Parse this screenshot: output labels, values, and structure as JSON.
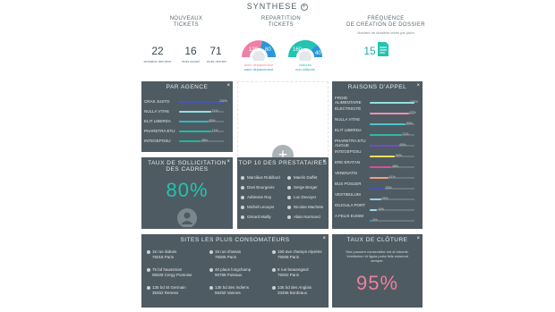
{
  "header": {
    "title": "SYNTHESE"
  },
  "tickets": {
    "title_line1": "NOUVEAUX",
    "title_line2": "TICKETS",
    "stats": [
      {
        "value": "22",
        "label": "semaine dernière"
      },
      {
        "value": "16",
        "label": "mois actuel"
      },
      {
        "value": "71",
        "label": "mois dernier"
      }
    ]
  },
  "repartition": {
    "title_line1": "REPARTITION",
    "title_line2": "TICKETS",
    "gauge_left": {
      "a": "120",
      "b": "80",
      "legend1": "avec déplacement",
      "legend2": "sans déplacement",
      "color_a": "#f07fa8",
      "color_b": "#2a97d8"
    },
    "gauge_right": {
      "a": "160",
      "b": "40",
      "legend1": "clôturés",
      "legend2": "non clôturés",
      "color_a": "#23c3b0",
      "color_b": "#2a97d8"
    }
  },
  "frequence": {
    "title_line1": "FRÉQUENCE",
    "title_line2": "DE CRÉATION DE DOSSIER",
    "subtitle": "Nombre de dossiers créés par jours",
    "value": "15"
  },
  "par_agence": {
    "title": "PAR AGENCE",
    "items": [
      {
        "label": "CRAS JUSTO",
        "pct": "100%",
        "value": 1.0,
        "color": "#4556b8"
      },
      {
        "label": "NULLA VITAE",
        "pct": "71%",
        "value": 0.71,
        "color": "#8fe0e8"
      },
      {
        "label": "ELIT LIBERDA",
        "pct": "65%",
        "value": 0.65,
        "color": "#2fb8c0"
      },
      {
        "label": "PHARETRA ETU",
        "pct": "71%",
        "value": 0.71,
        "color": "#23b8a8"
      },
      {
        "label": "INTEGEPOSU",
        "pct": "48%",
        "value": 0.48,
        "color": "#21b39c"
      }
    ]
  },
  "add_widget": {
    "symbol": "+"
  },
  "raisons": {
    "title": "RAISONS D'APPEL",
    "items": [
      {
        "label": "FROID ALIMENTAIRE",
        "pct": "100%",
        "value": 1.0,
        "color": "#8fe0e8"
      },
      {
        "label": "ÉLECTRICITÉ",
        "pct": "87%",
        "value": 0.87,
        "color": "#ef8fb8"
      },
      {
        "label": "NULLA VITAE",
        "pct": "80%",
        "value": 0.8,
        "color": "#4bc5ce"
      },
      {
        "label": "ELIT LIBERDA",
        "pct": "71%",
        "value": 0.71,
        "color": "#2fb8a8"
      },
      {
        "label": "PHARETRA ETU AUGUE",
        "pct": "65%",
        "value": 0.65,
        "color": "#6c4fc4"
      },
      {
        "label": "INTEGEPOSU",
        "pct": "56%",
        "value": 0.56,
        "color": "#e8e060"
      },
      {
        "label": "ERE ERATAN",
        "pct": "48%",
        "value": 0.48,
        "color": "#d64fa0"
      },
      {
        "label": "VENENATIS",
        "pct": "41%",
        "value": 0.41,
        "color": "#f0a080"
      },
      {
        "label": "BUS POSUER",
        "pct": "33%",
        "value": 0.33,
        "color": "#4556b8"
      },
      {
        "label": "VESTIBULUM",
        "pct": "25%",
        "value": 0.25,
        "color": "#8fd0e8"
      },
      {
        "label": "IDLIGULA PORT",
        "pct": "16%",
        "value": 0.16,
        "color": "#9fd8e8"
      },
      {
        "label": "A FELIS EUISM",
        "pct": "5%",
        "value": 0.05,
        "color": "#2a97d8"
      }
    ]
  },
  "sollicitation": {
    "title_line1": "TAUX DE SOLLICITATION",
    "title_line2": "DES CADRES",
    "value": "80%"
  },
  "prestataires": {
    "title": "TOP 10 DES PRESTATAIRES",
    "items": [
      "Marcilius Robillard",
      "Maelin Duffet",
      "Davi Bourgeois",
      "Serge Berger",
      "Adrienne Roy",
      "Luc Devoyer",
      "Michel Leouyer",
      "Nicolas Machete",
      "Gérard Mailly",
      "Alain Normand"
    ]
  },
  "sites": {
    "title": "SITES LES PLUS CONSOMATEURS",
    "items": [
      {
        "line1": "15 rue dubois",
        "line2": "75018 Paris"
      },
      {
        "line1": "15 rue d'assas",
        "line2": "75006 Paris"
      },
      {
        "line1": "150 ave champs elysées",
        "line2": "75008 Paris"
      },
      {
        "line1": "75 bd haussman",
        "line2": "95028 Cergy Pontoise"
      },
      {
        "line1": "40 place longchamp",
        "line2": "90788 Puteaux"
      },
      {
        "line1": "8 rue beauregard",
        "line2": "75002 Paris"
      },
      {
        "line1": "135 bd St Germain",
        "line2": "35452 Rennes"
      },
      {
        "line1": "135 bd des Indiens",
        "line2": "56250 Vannes"
      },
      {
        "line1": "135 bd des Anglais",
        "line2": "33456 Bordeaux"
      }
    ]
  },
  "cloture": {
    "title": "TAUX DE CLÔTURE",
    "description": "Sed posuere consectetur est at lobortis. Vestibulum id ligula porta felis euismod semper.",
    "value": "95%"
  },
  "close_symbol": "×"
}
